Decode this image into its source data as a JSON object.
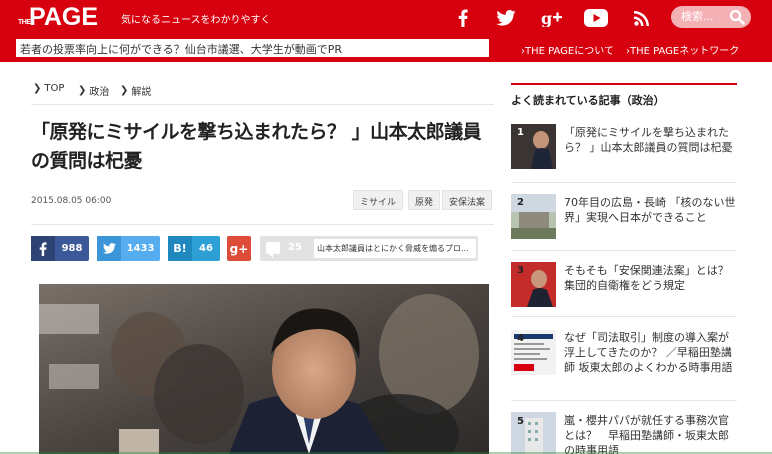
{
  "header": {
    "logo_the": "THE",
    "logo_page": "PAGE",
    "tagline": "気になるニュースをわかりやすく",
    "search_placeholder": "検索...",
    "top_headline": "若者の投票率向上に何ができる？仙台市議選、大学生が動画でPR",
    "links": [
      "THE PAGEについて",
      "THE PAGEネットワーク"
    ],
    "social_icons": [
      "facebook-icon",
      "twitter-icon",
      "google-plus-icon",
      "youtube-icon",
      "rss-icon"
    ],
    "brand_color": "#d7000f"
  },
  "breadcrumb": [
    "TOP",
    "政治",
    "解説"
  ],
  "article": {
    "title": "「原発にミサイルを撃ち込まれたら？ 」山本太郎議員の質問は杞憂",
    "date": "2015.08.05 06:00",
    "tags": [
      "ミサイル",
      "原発",
      "安保法案"
    ]
  },
  "share": {
    "facebook": "988",
    "twitter": "1433",
    "hatena_label": "B!",
    "hatena": "46",
    "gplus_label": "g+",
    "comments": "25",
    "comment_snippet": "山本太郎議員はとにかく脅威を煽るプロ..."
  },
  "sidebar": {
    "heading": "よく読まれている記事（政治）",
    "items": [
      {
        "rank": "1",
        "text": "「原発にミサイルを撃ち込まれたら？ 」山本太郎議員の質問は杞憂"
      },
      {
        "rank": "2",
        "text": "70年目の広島・長崎 「核のない世界」実現へ日本ができること"
      },
      {
        "rank": "3",
        "text": "そもそも「安保関連法案」とは？　集団的自衛権をどう規定"
      },
      {
        "rank": "4",
        "text": "なぜ「司法取引」制度の導入案が浮上してきたのか？ ／早稲田塾講師 坂東太郎のよくわかる時事用語"
      },
      {
        "rank": "5",
        "text": "嵐・櫻井パパが就任する事務次官とは？　早稲田塾講師・坂東太郎の時事用語"
      }
    ]
  },
  "colors": {
    "facebook": "#3b5998",
    "twitter": "#55acee",
    "hatena": "#2c9fd5",
    "gplus": "#dd4b39",
    "comment": "#e2e2e2"
  }
}
